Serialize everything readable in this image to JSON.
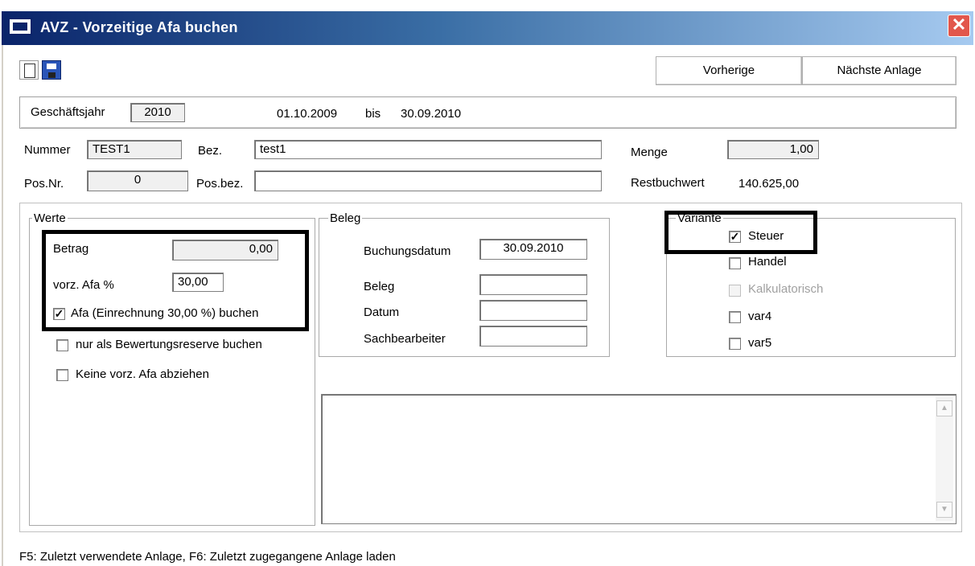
{
  "window": {
    "title": "AVZ - Vorzeitige Afa buchen",
    "close_symbol": "✕",
    "icon": "app-window-icon"
  },
  "toolbar": {
    "new_icon": "new-document-icon",
    "save_icon": "save-disk-icon",
    "prev_label": "Vorherige",
    "next_label": "Nächste Anlage"
  },
  "fiscal": {
    "label": "Geschäftsjahr",
    "year": "2010",
    "from": "01.10.2009",
    "bis": "bis",
    "to": "30.09.2010"
  },
  "header": {
    "nummer_label": "Nummer",
    "nummer_value": "TEST1",
    "bez_label": "Bez.",
    "bez_value": "test1",
    "menge_label": "Menge",
    "menge_value": "1,00",
    "posnr_label": "Pos.Nr.",
    "posnr_value": "0",
    "posbez_label": "Pos.bez.",
    "posbez_value": "",
    "restbuchwert_label": "Restbuchwert",
    "restbuchwert_value": "140.625,00"
  },
  "werte": {
    "title": "Werte",
    "betrag_label": "Betrag",
    "betrag_value": "0,00",
    "afa_pct_label": "vorz. Afa %",
    "afa_pct_value": "30,00",
    "cb_afa_label": "Afa (Einrechnung 30,00 %) buchen",
    "cb_afa_checked": true,
    "cb_reserve_label": "nur als Bewertungsreserve buchen",
    "cb_reserve_checked": false,
    "cb_keine_label": "Keine vorz. Afa abziehen",
    "cb_keine_checked": false
  },
  "beleg": {
    "title": "Beleg",
    "buchungsdatum_label": "Buchungsdatum",
    "buchungsdatum_value": "30.09.2010",
    "beleg_label": "Beleg",
    "beleg_value": "",
    "datum_label": "Datum",
    "datum_value": "",
    "sachbearbeiter_label": "Sachbearbeiter",
    "sachbearbeiter_value": ""
  },
  "variante": {
    "title": "Variante",
    "items": [
      {
        "label": "Steuer",
        "checked": true,
        "enabled": true
      },
      {
        "label": "Handel",
        "checked": false,
        "enabled": true
      },
      {
        "label": "Kalkulatorisch",
        "checked": false,
        "enabled": false
      },
      {
        "label": "var4",
        "checked": false,
        "enabled": true
      },
      {
        "label": "var5",
        "checked": false,
        "enabled": true
      }
    ]
  },
  "memo": {
    "value": ""
  },
  "status": {
    "text": "F5: Zuletzt verwendete Anlage, F6: Zuletzt zugegangene Anlage laden"
  }
}
